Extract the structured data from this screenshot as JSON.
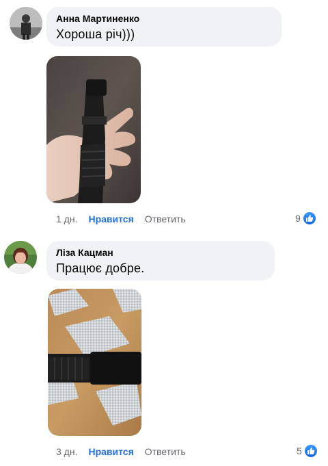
{
  "comments": [
    {
      "author": "Анна Мартиненко",
      "text": "Хороша річ)))",
      "time": "1 дн.",
      "like_label": "Нравится",
      "reply_label": "Ответить",
      "reaction_count": "9",
      "reaction_icon": "thumbs-up-icon",
      "photo_alt": "flashlight-in-hand-photo"
    },
    {
      "author": "Ліза Кацман",
      "text": "Працює добре.",
      "time": "3 дн.",
      "like_label": "Нравится",
      "reply_label": "Ответить",
      "reaction_count": "5",
      "reaction_icon": "thumbs-up-icon",
      "photo_alt": "flashlight-on-table-photo"
    }
  ],
  "colors": {
    "bubble": "#f0f2f5",
    "like_link": "#216fdb",
    "meta": "#65676b",
    "reaction": "#1877f2"
  }
}
